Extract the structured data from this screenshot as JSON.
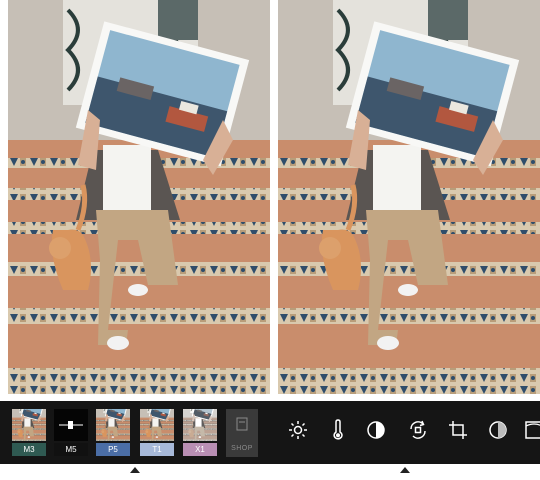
{
  "left_panel": {
    "filters": [
      {
        "code": "M3",
        "label_color": "#2f5a52"
      },
      {
        "code": "M5",
        "label_color": "#111111"
      },
      {
        "code": "P5",
        "label_color": "#4b6ea6"
      },
      {
        "code": "T1",
        "label_color": "#a7b9d9"
      },
      {
        "code": "X1",
        "label_color": "#b98fb4"
      }
    ],
    "shop_label": "SHOP"
  },
  "right_panel": {
    "tools": [
      {
        "icon": "brightness-icon"
      },
      {
        "icon": "thermometer-icon"
      },
      {
        "icon": "contrast-icon"
      },
      {
        "icon": "rotate-icon"
      },
      {
        "icon": "crop-icon"
      },
      {
        "icon": "fade-icon"
      },
      {
        "icon": "frame-icon"
      }
    ]
  },
  "colors": {
    "toolbar_bg": "#151515",
    "shop_bg": "#3a3a3a"
  }
}
